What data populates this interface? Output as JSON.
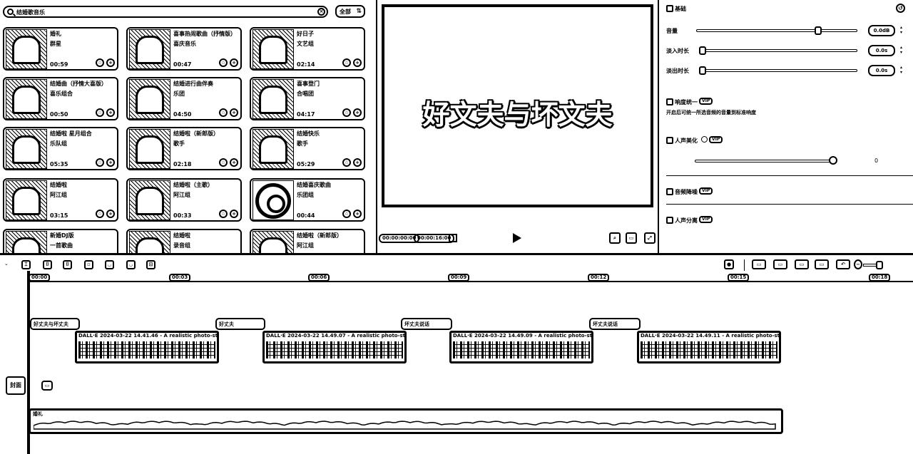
{
  "library": {
    "search_text": "结婚歌音乐",
    "filter_label": "全部",
    "items": [
      {
        "title": "婚礼",
        "artist": "群星",
        "duration": "00:59"
      },
      {
        "title": "喜事热闹歌曲（抒情版）",
        "artist": "喜庆音乐",
        "duration": "00:47"
      },
      {
        "title": "好日子",
        "artist": "文艺组",
        "duration": "02:14"
      },
      {
        "title": "结婚曲（抒情大喜版）",
        "artist": "喜乐组合",
        "duration": "00:50"
      },
      {
        "title": "结婚进行曲伴奏",
        "artist": "乐团",
        "duration": "04:50"
      },
      {
        "title": "喜事登门",
        "artist": "合唱团",
        "duration": "04:17"
      },
      {
        "title": "结婚啦 星月组合",
        "artist": "乐队组",
        "duration": "05:35"
      },
      {
        "title": "结婚啦（新郎版）",
        "artist": "歌手",
        "duration": "02:18"
      },
      {
        "title": "结婚快乐",
        "artist": "歌手",
        "duration": "05:29"
      },
      {
        "title": "结婚啦",
        "artist": "阿江组",
        "duration": "03:15"
      },
      {
        "title": "结婚啦（主歌）",
        "artist": "阿江组",
        "duration": "00:33"
      },
      {
        "title": "结婚喜庆歌曲",
        "artist": "乐团组",
        "duration": "00:44"
      },
      {
        "title": "新婚DJ版",
        "artist": "一首歌曲",
        "duration": ""
      },
      {
        "title": "结婚啦",
        "artist": "录音组",
        "duration": ""
      },
      {
        "title": "结婚啦（新郎版）",
        "artist": "阿江组",
        "duration": ""
      }
    ]
  },
  "player": {
    "caption": "好文夫与坏文夫",
    "current_time": "00:00:00:00",
    "total_time": "00:00:16:00"
  },
  "props": {
    "basic_label": "基础",
    "volume_label": "音量",
    "volume_value": "0.0dB",
    "fadein_label": "淡入时长",
    "fadein_value": "0.0s",
    "fadeout_label": "淡出时长",
    "fadeout_value": "0.0s",
    "loudness_label": "响度统一",
    "loudness_tag": "VIP",
    "loudness_desc": "开启后可统一所选音频的音量到标准响度",
    "voice_label": "人声美化",
    "voice_tag": "VIP",
    "voice_value": "0",
    "denoise_label": "音频降噪",
    "denoise_tag": "VIP",
    "separate_label": "人声分离",
    "separate_tag": "VIP"
  },
  "timeline": {
    "ruler": [
      "00:00",
      "00:03",
      "00:06",
      "00:09",
      "00:12",
      "00:15",
      "00:18"
    ],
    "subtitles": [
      "好丈夫与坏丈夫",
      "好丈夫",
      "坏丈夫说话",
      "坏丈夫说话"
    ],
    "clips": [
      "DALL·E 2024-03-22 14.41.46 - A realistic photo-style",
      "DALL·E 2024-03-22 14.49.07 - A realistic photo-style",
      "DALL·E 2024-03-22 14.49.09 - A realistic photo-style",
      "DALL·E 2024-03-22 14.49.11 - A realistic photo-style"
    ],
    "cover_label": "封面",
    "audio_name": "婚礼"
  }
}
